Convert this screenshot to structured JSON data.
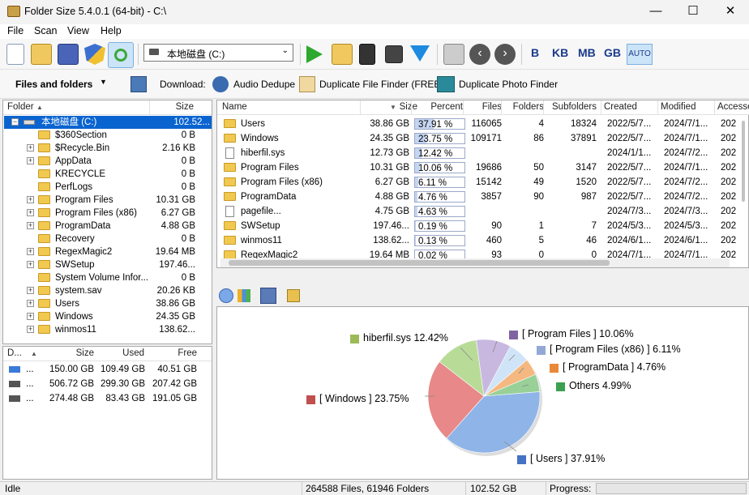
{
  "window": {
    "title": "Folder Size 5.4.0.1 (64-bit) - C:\\",
    "min": "—",
    "max": "☐",
    "close": "✕"
  },
  "menu": [
    "File",
    "Scan",
    "View",
    "Help"
  ],
  "toolbar": {
    "drive": "本地磁盘 (C:)",
    "units": [
      "B",
      "KB",
      "MB",
      "GB",
      "AUTO"
    ]
  },
  "toolbar2": {
    "view_mode": "Files and folders",
    "download_label": "Download:",
    "links": [
      "Audio Dedupe",
      "Duplicate File Finder (FREE)",
      "Duplicate Photo Finder"
    ]
  },
  "tree": {
    "col_folder": "Folder",
    "col_size": "Size",
    "root": {
      "name": "本地磁盘 (C:)",
      "size": "102.52..."
    },
    "items": [
      {
        "name": "$360Section",
        "size": "0 B",
        "exp": false
      },
      {
        "name": "$Recycle.Bin",
        "size": "2.16 KB",
        "exp": true
      },
      {
        "name": "AppData",
        "size": "0 B",
        "exp": true
      },
      {
        "name": "KRECYCLE",
        "size": "0 B",
        "exp": false
      },
      {
        "name": "PerfLogs",
        "size": "0 B",
        "exp": false
      },
      {
        "name": "Program Files",
        "size": "10.31 GB",
        "exp": true
      },
      {
        "name": "Program Files (x86)",
        "size": "6.27 GB",
        "exp": true
      },
      {
        "name": "ProgramData",
        "size": "4.88 GB",
        "exp": true
      },
      {
        "name": "Recovery",
        "size": "0 B",
        "exp": false
      },
      {
        "name": "RegexMagic2",
        "size": "19.64 MB",
        "exp": true
      },
      {
        "name": "SWSetup",
        "size": "197.46...",
        "exp": true
      },
      {
        "name": "System Volume Infor...",
        "size": "0 B",
        "exp": false
      },
      {
        "name": "system.sav",
        "size": "20.26 KB",
        "exp": true
      },
      {
        "name": "Users",
        "size": "38.86 GB",
        "exp": true
      },
      {
        "name": "Windows",
        "size": "24.35 GB",
        "exp": true
      },
      {
        "name": "winmos11",
        "size": "138.62...",
        "exp": true
      }
    ]
  },
  "drives": {
    "cols": [
      "D...",
      "Size",
      "Used",
      "Free"
    ],
    "rows": [
      {
        "d": "...",
        "size": "150.00 GB",
        "used": "109.49 GB",
        "free": "40.51 GB"
      },
      {
        "d": "...",
        "size": "506.72 GB",
        "used": "299.30 GB",
        "free": "207.42 GB"
      },
      {
        "d": "...",
        "size": "274.48 GB",
        "used": "83.43 GB",
        "free": "191.05 GB"
      }
    ]
  },
  "list": {
    "cols": [
      "Name",
      "Size",
      "Percent",
      "Files",
      "Folders",
      "Subfolders",
      "Created",
      "Modified",
      "Accesse"
    ],
    "rows": [
      {
        "name": "Users",
        "file": false,
        "size": "38.86 GB",
        "pct": "37.91 %",
        "pv": 37.91,
        "files": "116065",
        "folders": "4",
        "sub": "18324",
        "created": "2022/5/7...",
        "modified": "2024/7/1...",
        "acc": "202"
      },
      {
        "name": "Windows",
        "file": false,
        "size": "24.35 GB",
        "pct": "23.75 %",
        "pv": 23.75,
        "files": "109171",
        "folders": "86",
        "sub": "37891",
        "created": "2022/5/7...",
        "modified": "2024/7/1...",
        "acc": "202"
      },
      {
        "name": "hiberfil.sys",
        "file": true,
        "size": "12.73 GB",
        "pct": "12.42 %",
        "pv": 12.42,
        "files": "",
        "folders": "",
        "sub": "",
        "created": "2024/1/1...",
        "modified": "2024/7/2...",
        "acc": "202"
      },
      {
        "name": "Program Files",
        "file": false,
        "size": "10.31 GB",
        "pct": "10.06 %",
        "pv": 10.06,
        "files": "19686",
        "folders": "50",
        "sub": "3147",
        "created": "2022/5/7...",
        "modified": "2024/7/1...",
        "acc": "202"
      },
      {
        "name": "Program Files (x86)",
        "file": false,
        "size": "6.27 GB",
        "pct": "6.11 %",
        "pv": 6.11,
        "files": "15142",
        "folders": "49",
        "sub": "1520",
        "created": "2022/5/7...",
        "modified": "2024/7/2...",
        "acc": "202"
      },
      {
        "name": "ProgramData",
        "file": false,
        "size": "4.88 GB",
        "pct": "4.76 %",
        "pv": 4.76,
        "files": "3857",
        "folders": "90",
        "sub": "987",
        "created": "2022/5/7...",
        "modified": "2024/7/2...",
        "acc": "202"
      },
      {
        "name": "pagefile...",
        "file": true,
        "size": "4.75 GB",
        "pct": "4.63 %",
        "pv": 4.63,
        "files": "",
        "folders": "",
        "sub": "",
        "created": "2024/7/3...",
        "modified": "2024/7/3...",
        "acc": "202"
      },
      {
        "name": "SWSetup",
        "file": false,
        "size": "197.46...",
        "pct": "0.19 %",
        "pv": 0.19,
        "files": "90",
        "folders": "1",
        "sub": "7",
        "created": "2024/5/3...",
        "modified": "2024/5/3...",
        "acc": "202"
      },
      {
        "name": "winmos11",
        "file": false,
        "size": "138.62...",
        "pct": "0.13 %",
        "pv": 0.13,
        "files": "460",
        "folders": "5",
        "sub": "46",
        "created": "2024/6/1...",
        "modified": "2024/6/1...",
        "acc": "202"
      },
      {
        "name": "RegexMagic2",
        "file": false,
        "size": "19.64 MB",
        "pct": "0.02 %",
        "pv": 0.02,
        "files": "93",
        "folders": "0",
        "sub": "0",
        "created": "2024/7/1...",
        "modified": "2024/7/1...",
        "acc": "202"
      }
    ]
  },
  "chart_data": {
    "type": "pie",
    "slices": [
      {
        "label": "[ Users ] 37.91%",
        "value": 37.91,
        "color": "#8fb4e8"
      },
      {
        "label": "[ Windows ] 23.75%",
        "value": 23.75,
        "color": "#e88888"
      },
      {
        "label": "hiberfil.sys 12.42%",
        "value": 12.42,
        "color": "#b8dc98"
      },
      {
        "label": "[ Program Files ] 10.06%",
        "value": 10.06,
        "color": "#c8b8e0"
      },
      {
        "label": "[ Program Files (x86) ] 6.11%",
        "value": 6.11,
        "color": "#d0e4f8"
      },
      {
        "label": "[ ProgramData ] 4.76%",
        "value": 4.76,
        "color": "#f4b880"
      },
      {
        "label": "Others 4.99%",
        "value": 4.99,
        "color": "#98d098"
      }
    ],
    "legend_colors": [
      "#4472c4",
      "#c0504d",
      "#9bbb59",
      "#8064a2",
      "#94a8d8",
      "#e8883a",
      "#3ca050"
    ]
  },
  "status": {
    "state": "Idle",
    "counts": "264588 Files, 61946 Folders",
    "total": "102.52 GB",
    "progress_label": "Progress:"
  }
}
